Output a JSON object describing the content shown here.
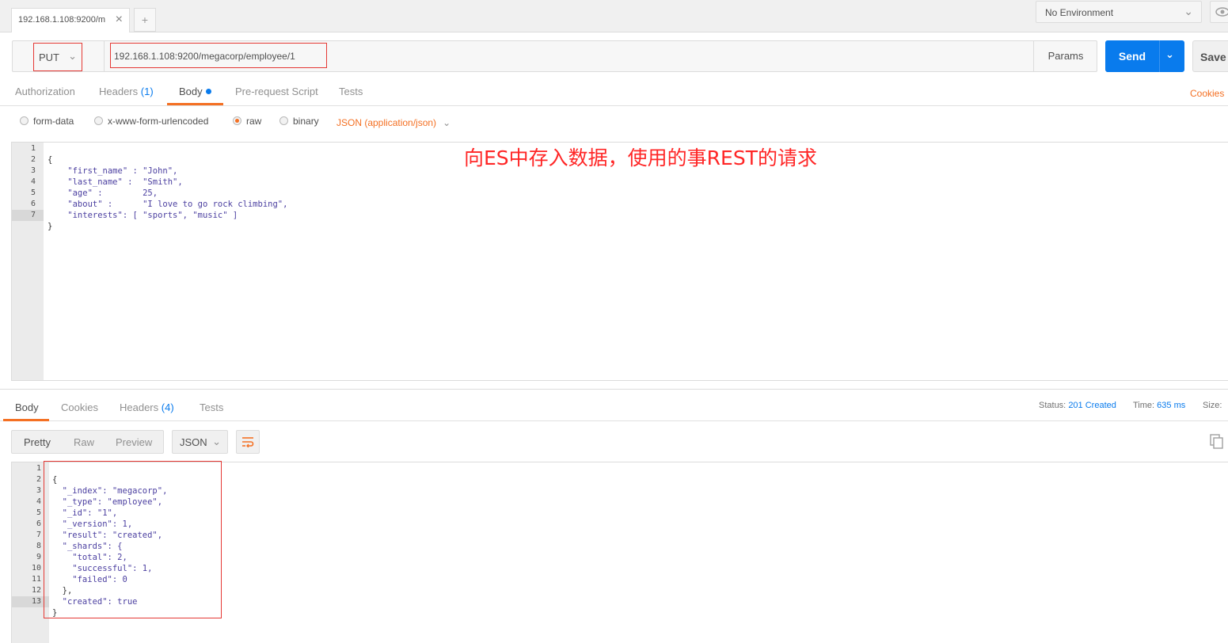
{
  "top": {
    "tab_title": "192.168.1.108:9200/m",
    "tab_close": "×",
    "new_tab": "+",
    "environment": "No Environment"
  },
  "request": {
    "method": "PUT",
    "url": "192.168.1.108:9200/megacorp/employee/1",
    "params_label": "Params",
    "send_label": "Send",
    "save_label": "Save"
  },
  "request_tabs": {
    "authorization": "Authorization",
    "headers": "Headers",
    "headers_count": "(1)",
    "body": "Body",
    "pre_request": "Pre-request Script",
    "tests": "Tests",
    "cookies": "Cookies"
  },
  "body_types": {
    "form_data": "form-data",
    "urlencoded": "x-www-form-urlencoded",
    "raw": "raw",
    "binary": "binary",
    "selected": "raw",
    "content_type": "JSON (application/json)"
  },
  "request_body": {
    "line_numbers": [
      "1",
      "2",
      "3",
      "4",
      "5",
      "6",
      "7"
    ],
    "lines": [
      "{",
      "    \"first_name\" : \"John\",",
      "    \"last_name\" :  \"Smith\",",
      "    \"age\" :        25,",
      "    \"about\" :      \"I love to go rock climbing\",",
      "    \"interests\": [ \"sports\", \"music\" ]",
      "}"
    ]
  },
  "annotation": "向ES中存入数据，使用的事REST的请求",
  "response_tabs": {
    "body": "Body",
    "cookies": "Cookies",
    "headers": "Headers",
    "headers_count": "(4)",
    "tests": "Tests"
  },
  "response_meta": {
    "status_label": "Status:",
    "status_value": "201 Created",
    "time_label": "Time:",
    "time_value": "635 ms",
    "size_label": "Size:"
  },
  "response_view": {
    "pretty": "Pretty",
    "raw": "Raw",
    "preview": "Preview",
    "format": "JSON"
  },
  "response_body": {
    "line_numbers": [
      "1",
      "2",
      "3",
      "4",
      "5",
      "6",
      "7",
      "8",
      "9",
      "10",
      "11",
      "12",
      "13"
    ],
    "lines": [
      "{",
      "  \"_index\": \"megacorp\",",
      "  \"_type\": \"employee\",",
      "  \"_id\": \"1\",",
      "  \"_version\": 1,",
      "  \"result\": \"created\",",
      "  \"_shards\": {",
      "    \"total\": 2,",
      "    \"successful\": 1,",
      "    \"failed\": 0",
      "  },",
      "  \"created\": true",
      "}"
    ]
  },
  "colors": {
    "accent": "#f47023",
    "send": "#097bed",
    "annotation": "#ff2626",
    "highlight_box": "#e53935"
  }
}
